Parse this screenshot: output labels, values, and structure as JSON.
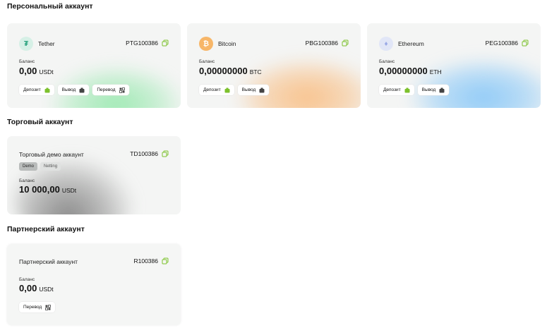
{
  "colors": {
    "tether": "#26a17b",
    "bitcoin": "#f7931a",
    "ethereum": "#627eea",
    "copy_icon": "#7cc12c",
    "glow_green": "#9ee9b3",
    "glow_orange": "#f8c28c",
    "glow_blue": "#8fcaf7",
    "glow_gray": "#9a9a9a"
  },
  "sections": {
    "personal": "Персональный аккаунт",
    "trading": "Торговый аккаунт",
    "partner": "Партнерский аккаунт"
  },
  "personal_accounts": [
    {
      "coin": "Tether",
      "coin_symbol": "₮",
      "icon": "tether-icon",
      "id": "PTG100386",
      "balance_label": "Баланс",
      "balance": "0,00",
      "currency": "USDt",
      "buttons": [
        "Депозит",
        "Вывод",
        "Перевод"
      ]
    },
    {
      "coin": "Bitcoin",
      "coin_symbol": "₿",
      "icon": "bitcoin-icon",
      "id": "PBG100386",
      "balance_label": "Баланс",
      "balance": "0,00000000",
      "currency": "BTC",
      "buttons": [
        "Депозит",
        "Вывод"
      ]
    },
    {
      "coin": "Ethereum",
      "coin_symbol": "♦",
      "icon": "ethereum-icon",
      "id": "PEG100386",
      "balance_label": "Баланс",
      "balance": "0,00000000",
      "currency": "ETH",
      "buttons": [
        "Депозит",
        "Вывод"
      ]
    }
  ],
  "trading_account": {
    "name": "Торговый демо аккаунт",
    "id": "TD100386",
    "tags": [
      "Demo",
      "Netting"
    ],
    "balance_label": "Баланс",
    "balance": "10 000,00",
    "currency": "USDt"
  },
  "partner_account": {
    "name": "Партнерский аккаунт",
    "id": "R100386",
    "balance_label": "Баланс",
    "balance": "0,00",
    "currency": "USDt",
    "buttons": [
      "Перевод"
    ]
  }
}
